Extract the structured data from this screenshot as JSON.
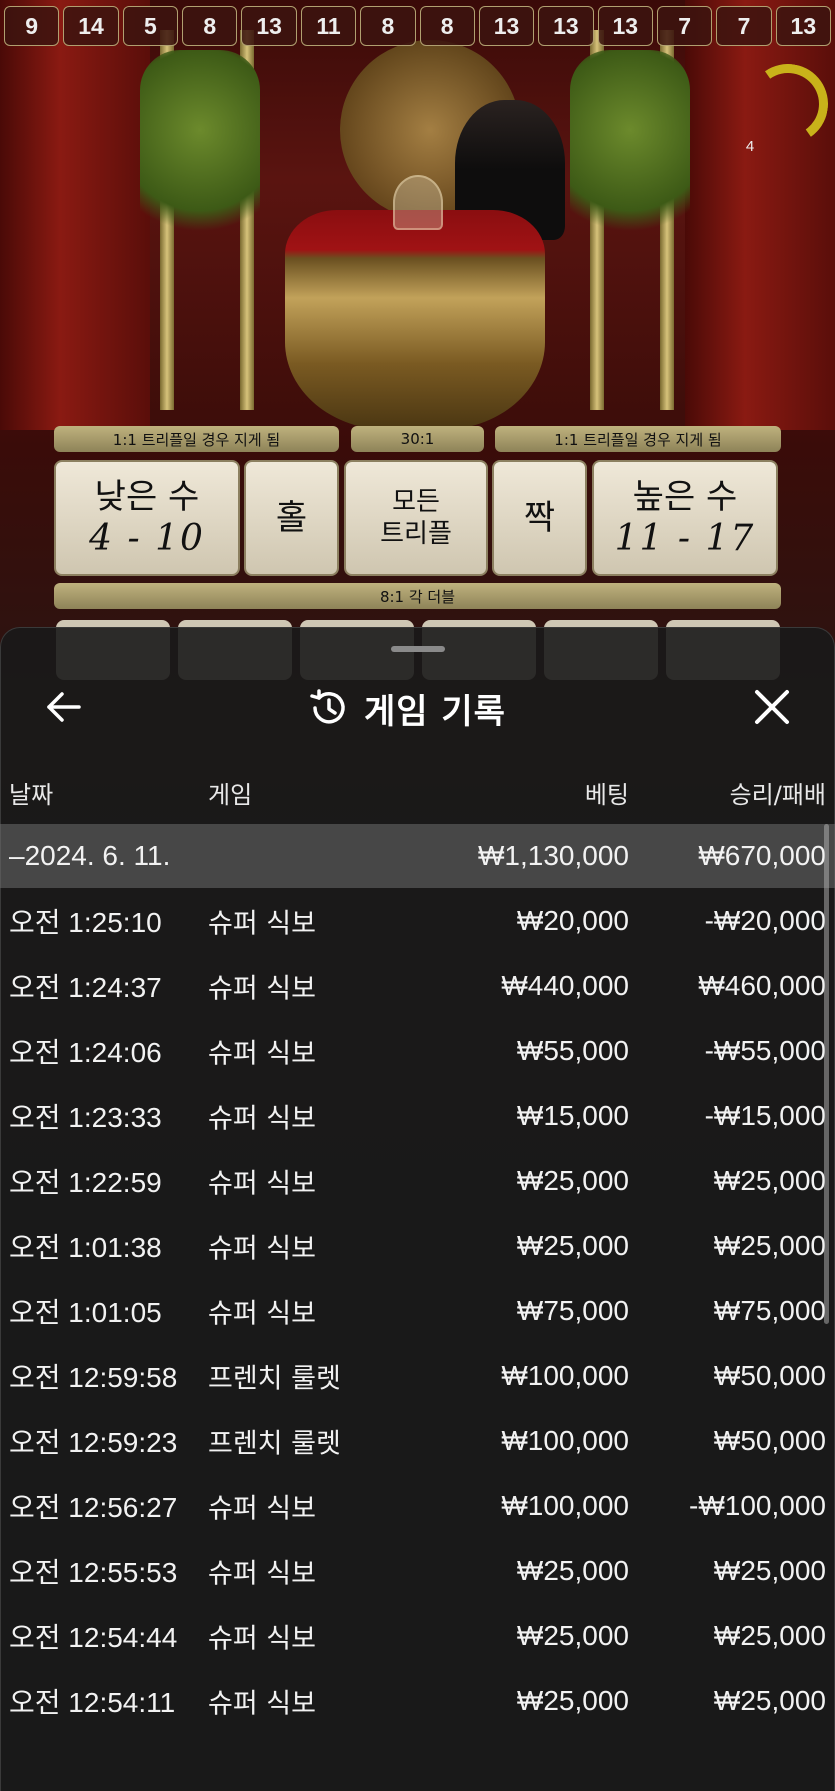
{
  "history_strip": [
    "9",
    "14",
    "5",
    "8",
    "13",
    "11",
    "8",
    "8",
    "13",
    "13",
    "13",
    "7",
    "7",
    "13"
  ],
  "timer": {
    "value": "4",
    "color": "#c9b21a"
  },
  "bet_board": {
    "banner_left": "1:1 트리플일 경우 지게 됨",
    "banner_center": "30:1",
    "banner_right": "1:1 트리플일 경우 지게 됨",
    "small_label": "낮은 수",
    "small_range": "4 - 10",
    "odd_label": "홀",
    "any_triple_line1": "모든",
    "any_triple_line2": "트리플",
    "even_label": "짝",
    "big_label": "높은 수",
    "big_range": "11 - 17",
    "double_banner": "8:1 각 더블"
  },
  "sheet": {
    "title": "게임 기록",
    "icons": {
      "back": "back-arrow-icon",
      "history": "history-icon",
      "close": "close-icon"
    },
    "columns": {
      "date": "날짜",
      "game": "게임",
      "bet": "베팅",
      "win_loss": "승리/패배"
    },
    "day_summary": {
      "date": "–2024. 6. 11.",
      "bet": "₩1,130,000",
      "win_loss": "₩670,000"
    },
    "rows": [
      {
        "time": "오전 1:25:10",
        "game": "슈퍼 식보",
        "bet": "₩20,000",
        "win_loss": "-₩20,000"
      },
      {
        "time": "오전 1:24:37",
        "game": "슈퍼 식보",
        "bet": "₩440,000",
        "win_loss": "₩460,000"
      },
      {
        "time": "오전 1:24:06",
        "game": "슈퍼 식보",
        "bet": "₩55,000",
        "win_loss": "-₩55,000"
      },
      {
        "time": "오전 1:23:33",
        "game": "슈퍼 식보",
        "bet": "₩15,000",
        "win_loss": "-₩15,000"
      },
      {
        "time": "오전 1:22:59",
        "game": "슈퍼 식보",
        "bet": "₩25,000",
        "win_loss": "₩25,000"
      },
      {
        "time": "오전 1:01:38",
        "game": "슈퍼 식보",
        "bet": "₩25,000",
        "win_loss": "₩25,000"
      },
      {
        "time": "오전 1:01:05",
        "game": "슈퍼 식보",
        "bet": "₩75,000",
        "win_loss": "₩75,000"
      },
      {
        "time": "오전 12:59:58",
        "game": "프렌치 룰렛",
        "bet": "₩100,000",
        "win_loss": "₩50,000"
      },
      {
        "time": "오전 12:59:23",
        "game": "프렌치 룰렛",
        "bet": "₩100,000",
        "win_loss": "₩50,000"
      },
      {
        "time": "오전 12:56:27",
        "game": "슈퍼 식보",
        "bet": "₩100,000",
        "win_loss": "-₩100,000"
      },
      {
        "time": "오전 12:55:53",
        "game": "슈퍼 식보",
        "bet": "₩25,000",
        "win_loss": "₩25,000"
      },
      {
        "time": "오전 12:54:44",
        "game": "슈퍼 식보",
        "bet": "₩25,000",
        "win_loss": "₩25,000"
      },
      {
        "time": "오전 12:54:11",
        "game": "슈퍼 식보",
        "bet": "₩25,000",
        "win_loss": "₩25,000"
      }
    ]
  }
}
